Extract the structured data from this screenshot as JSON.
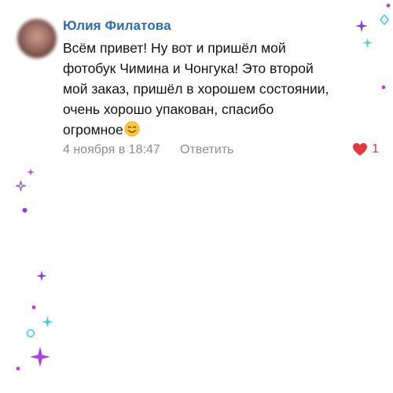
{
  "comment": {
    "author": "Юлия Филатова",
    "text_lines": [
      "Всём привет! Ну вот и пришёл мой",
      "фотобук Чимина и Чонгука! Это второй",
      "мой заказ, пришёл в хорошем состоянии,",
      "очень хорошо упакован, спасибо",
      "огромное"
    ],
    "emoji": "smiling-face-emoji",
    "timestamp": "4 ноября в 18:47",
    "reply_label": "Ответить",
    "likes": "1"
  },
  "colors": {
    "author": "#2a6cb8",
    "meta": "#8a8d91",
    "like": "#e03a40",
    "sparkle_purple": "#8a3ee0",
    "sparkle_cyan": "#3fd0e0",
    "sparkle_magenta": "#c03cdc"
  }
}
